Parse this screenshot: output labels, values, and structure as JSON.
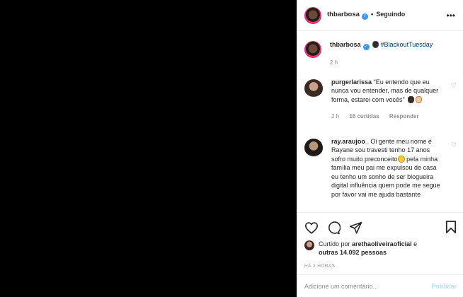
{
  "header": {
    "username": "thbarbosa",
    "separator": "•",
    "follow_status": "Seguindo",
    "more_icon": "more-horizontal-icon"
  },
  "caption": {
    "username": "thbarbosa",
    "hashtag": "#BlackoutTuesday",
    "time": "2 h"
  },
  "comments": [
    {
      "username": "purgerlarissa",
      "text": "\"Eu entendo que eu nunca vou entender, mas de qualquer forma, estarei com vocês\"",
      "time": "2 h",
      "likes": "16 curtidas",
      "reply": "Responder"
    },
    {
      "username": "ray.araujoo_",
      "text": "Oi gente meu nome é Rayane sou travesti tenho 17 anos sofro muito preconceito",
      "text2": "pela minha família meu pai me expulsou de casa eu tenho um sonho de ser blogueira digital influência quem pode me segue por favor vai me ajuda bastante"
    }
  ],
  "actions": {
    "liked_prefix": "Curtido por",
    "liked_user": "arethaoliveiraoficial",
    "liked_and": "e",
    "liked_others": "outras 14.092 pessoas",
    "timestamp": "HÁ 2 HORAS"
  },
  "add_comment": {
    "placeholder": "Adicione um comentário...",
    "publish": "Publicar"
  },
  "colors": {
    "verified": "#3897f0",
    "hashtag": "#00376b",
    "publish_disabled": "#b2dffc",
    "muted": "#8e8e8e"
  }
}
